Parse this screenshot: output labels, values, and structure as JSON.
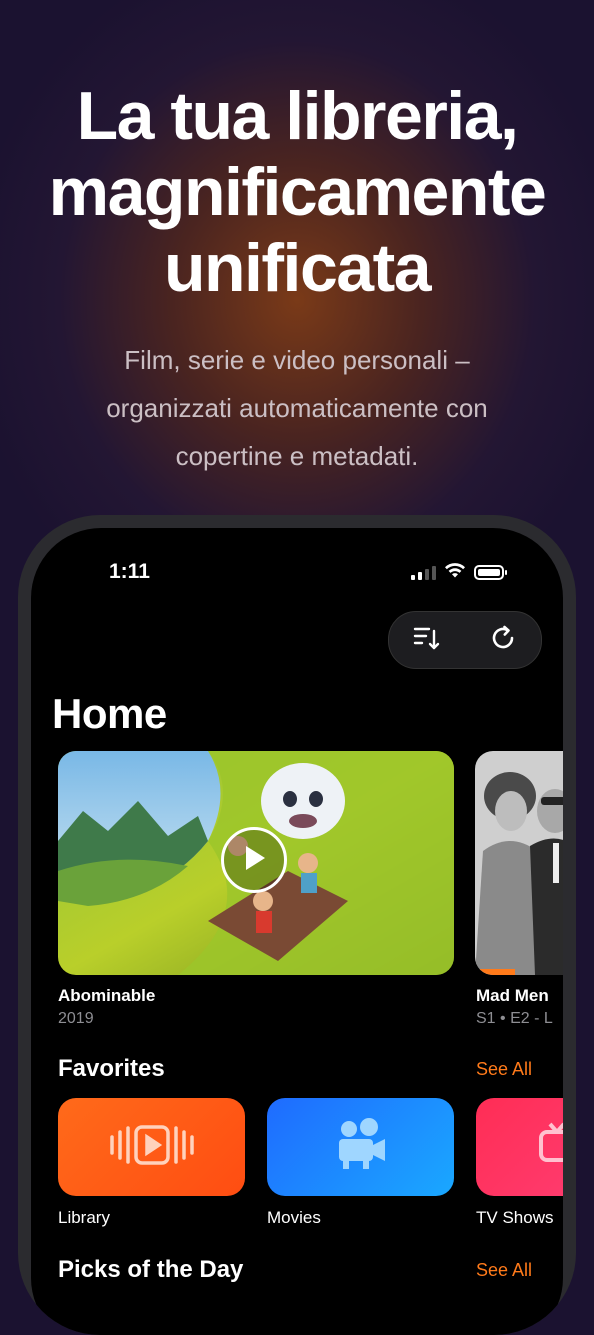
{
  "promo": {
    "headline": [
      "La tua libreria,",
      "magnificamente",
      "unificata"
    ],
    "subtitle": "Film, serie e video personali – organizzati automaticamente con copertine e metadati."
  },
  "status_bar": {
    "time": "1:11",
    "icons": [
      "cellular-signal-icon",
      "wifi-icon",
      "battery-icon"
    ]
  },
  "toolbar": {
    "icons": [
      "sort-icon",
      "refresh-icon"
    ]
  },
  "home": {
    "title": "Home",
    "continue_watching": [
      {
        "title": "Abominable",
        "subtitle": "2019",
        "icon": "play-icon"
      },
      {
        "title": "Mad Men",
        "subtitle": "S1 • E2 - L"
      }
    ],
    "favorites": {
      "title": "Favorites",
      "see_all": "See All",
      "items": [
        {
          "label": "Library",
          "icon": "video-library-icon",
          "color": "#ff5a14"
        },
        {
          "label": "Movies",
          "icon": "movie-camera-icon",
          "color": "#1a8cff"
        },
        {
          "label": "TV Shows",
          "icon": "tv-icon",
          "color": "#ff2d55"
        }
      ]
    },
    "picks": {
      "title": "Picks of the Day",
      "see_all": "See All"
    }
  },
  "colors": {
    "accent": "#ff7a1a",
    "screen_bg": "#000000"
  }
}
